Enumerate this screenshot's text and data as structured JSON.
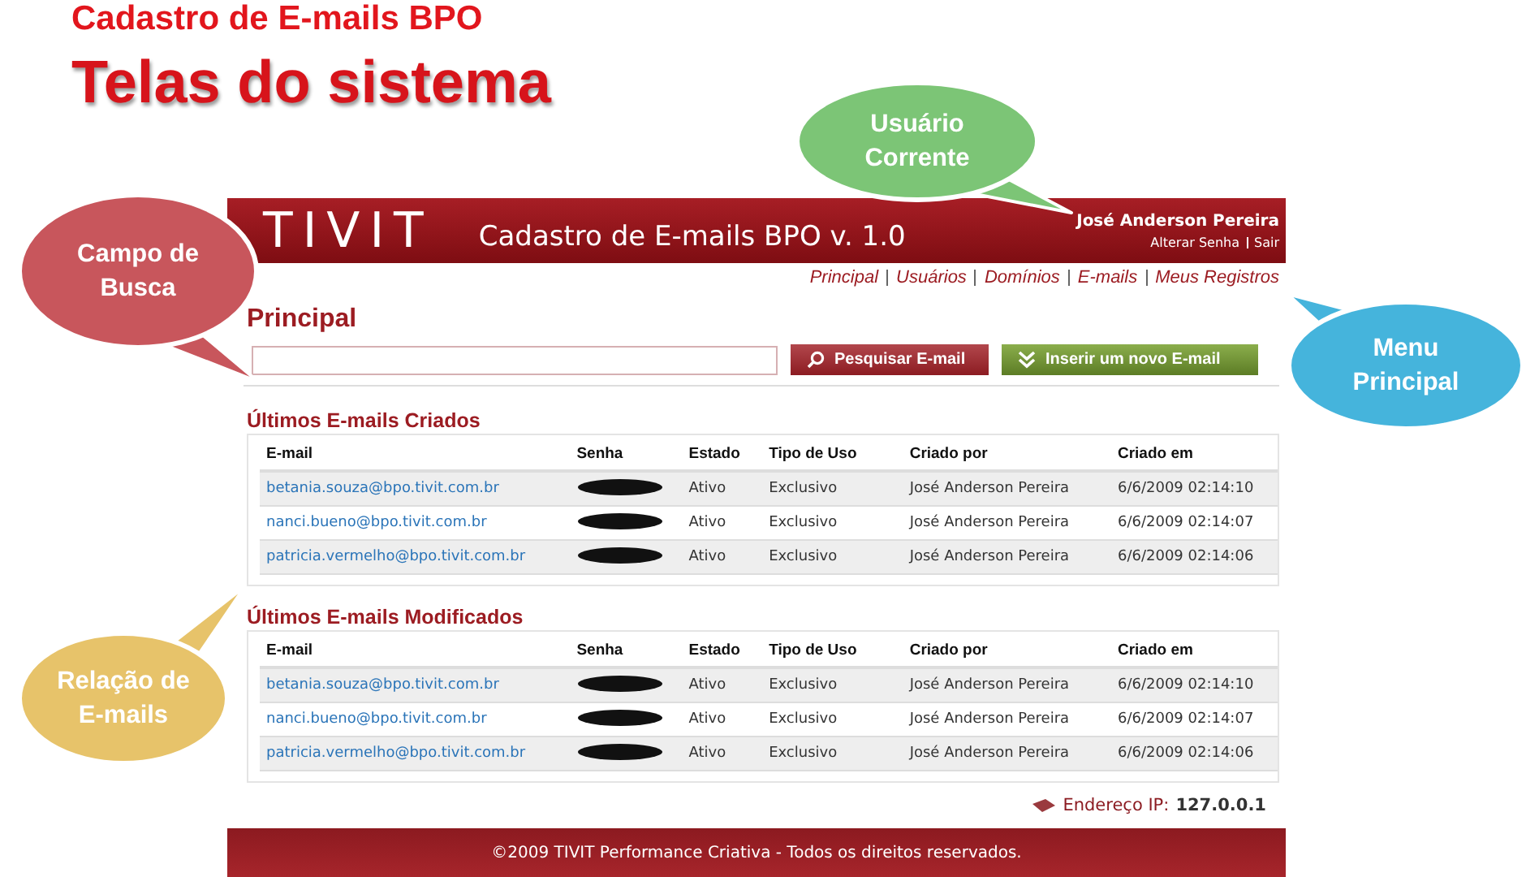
{
  "slide": {
    "subtitle": "Cadastro de E-mails BPO",
    "title": "Telas do sistema"
  },
  "header": {
    "logo": "TIVIT",
    "app_title": "Cadastro de E-mails BPO v. 1.0",
    "user": "José Anderson Pereira",
    "user_links": [
      "Alterar Senha",
      "Sair"
    ]
  },
  "nav": [
    "Principal",
    "Usuários",
    "Domínios",
    "E-mails",
    "Meus Registros"
  ],
  "page_title": "Principal",
  "search": {
    "button": "Pesquisar E-mail",
    "insert_button": "Inserir um novo E-mail"
  },
  "tables": [
    {
      "title": "Últimos E-mails Criados",
      "columns": [
        "E-mail",
        "Senha",
        "Estado",
        "Tipo de Uso",
        "Criado por",
        "Criado em"
      ],
      "rows": [
        {
          "email": "betania.souza@bpo.tivit.com.br",
          "estado": "Ativo",
          "tipo": "Exclusivo",
          "criado_por": "José Anderson Pereira",
          "criado_em": "6/6/2009 02:14:10"
        },
        {
          "email": "nanci.bueno@bpo.tivit.com.br",
          "estado": "Ativo",
          "tipo": "Exclusivo",
          "criado_por": "José Anderson Pereira",
          "criado_em": "6/6/2009 02:14:07"
        },
        {
          "email": "patricia.vermelho@bpo.tivit.com.br",
          "estado": "Ativo",
          "tipo": "Exclusivo",
          "criado_por": "José Anderson Pereira",
          "criado_em": "6/6/2009 02:14:06"
        }
      ]
    },
    {
      "title": "Últimos E-mails Modificados",
      "columns": [
        "E-mail",
        "Senha",
        "Estado",
        "Tipo de Uso",
        "Criado por",
        "Criado em"
      ],
      "rows": [
        {
          "email": "betania.souza@bpo.tivit.com.br",
          "estado": "Ativo",
          "tipo": "Exclusivo",
          "criado_por": "José Anderson Pereira",
          "criado_em": "6/6/2009 02:14:10"
        },
        {
          "email": "nanci.bueno@bpo.tivit.com.br",
          "estado": "Ativo",
          "tipo": "Exclusivo",
          "criado_por": "José Anderson Pereira",
          "criado_em": "6/6/2009 02:14:07"
        },
        {
          "email": "patricia.vermelho@bpo.tivit.com.br",
          "estado": "Ativo",
          "tipo": "Exclusivo",
          "criado_por": "José Anderson Pereira",
          "criado_em": "6/6/2009 02:14:06"
        }
      ]
    }
  ],
  "ip": {
    "label": "Endereço IP:",
    "value": "127.0.0.1"
  },
  "footer": "©2009 TIVIT Performance Criativa - Todos os direitos reservados.",
  "callouts": [
    {
      "kind": "usuario",
      "text": "Usuário Corrente",
      "color": "#7cc576"
    },
    {
      "kind": "busca",
      "text": "Campo de Busca",
      "color": "#c8565c"
    },
    {
      "kind": "menu",
      "text": "Menu Principal",
      "color": "#45b4dc"
    },
    {
      "kind": "relacao",
      "text": "Relação de E-mails",
      "color": "#e7c36a"
    }
  ]
}
